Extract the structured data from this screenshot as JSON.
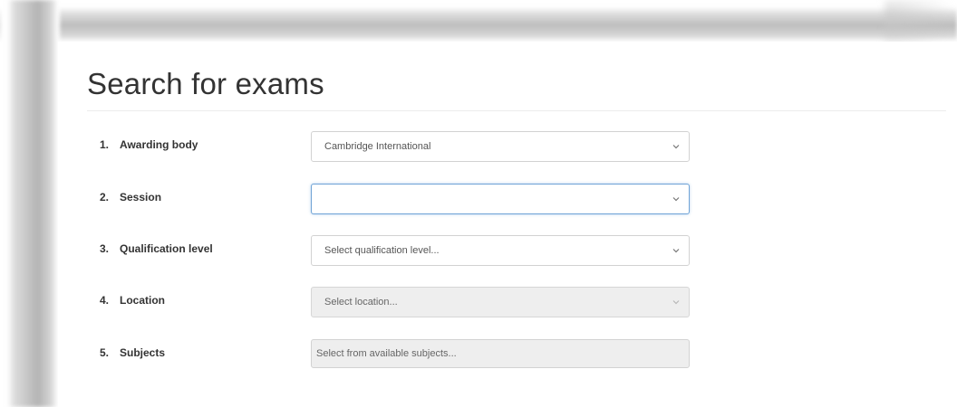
{
  "page": {
    "title": "Search for exams"
  },
  "form": {
    "rows": [
      {
        "number": "1.",
        "label": "Awarding body",
        "value": "Cambridge International",
        "state": "normal",
        "icon": "chevron-down-icon"
      },
      {
        "number": "2.",
        "label": "Session",
        "value": "",
        "state": "focused",
        "icon": "chevron-down-icon"
      },
      {
        "number": "3.",
        "label": "Qualification level",
        "value": "Select qualification level...",
        "state": "normal",
        "icon": "chevron-down-icon"
      },
      {
        "number": "4.",
        "label": "Location",
        "value": "Select location...",
        "state": "disabled",
        "icon": "chevron-down-icon"
      },
      {
        "number": "5.",
        "label": "Subjects",
        "placeholder": "Select from available subjects...",
        "state": "disabled"
      }
    ]
  },
  "colors": {
    "focus_border": "#6fa3d6",
    "disabled_background": "#eeeeee",
    "text": "#333333"
  }
}
